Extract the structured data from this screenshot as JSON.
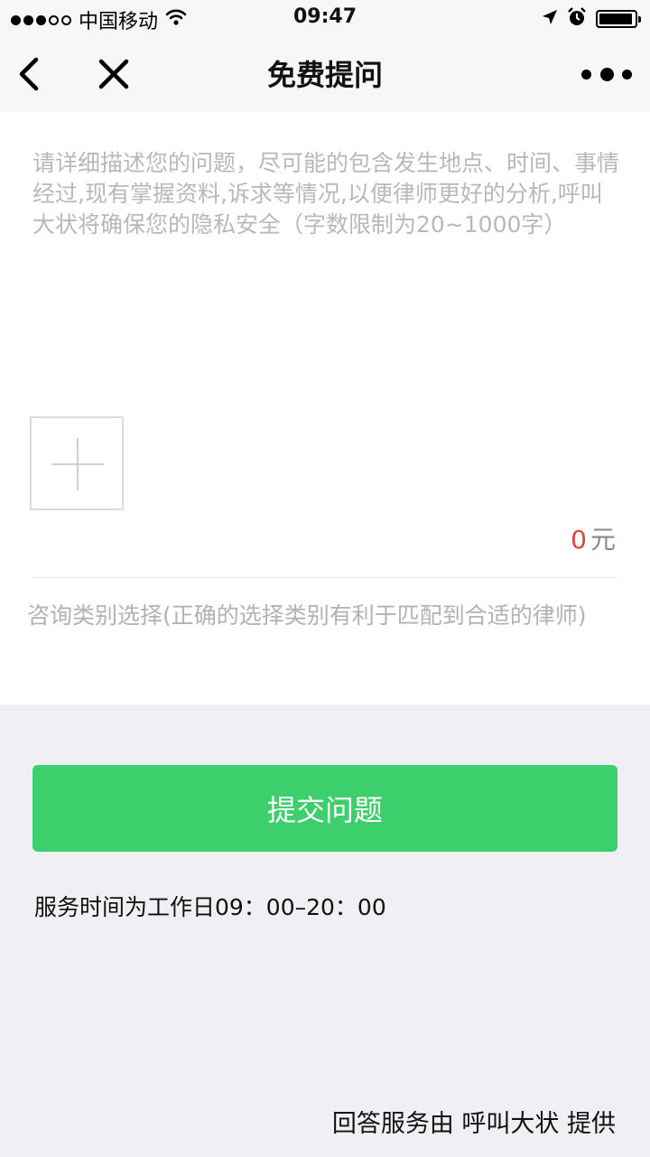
{
  "status_bar": {
    "carrier": "中国移动",
    "time": "09:47",
    "signal_bars": 3,
    "battery_level": 0.85
  },
  "nav": {
    "title": "免费提问",
    "back_icon": "chevron-left-icon",
    "close_icon": "close-icon",
    "more_icon": "more-dots-icon"
  },
  "form": {
    "question_placeholder": "请详细描述您的问题，尽可能的包含发生地点、时间、事情经过,现有掌握资料,诉求等情况,以便律师更好的分析,呼叫大状将确保您的隐私安全（字数限制为20~1000字）",
    "question_value": "",
    "upload_icon": "plus-icon",
    "price_amount": "0",
    "price_unit": "元",
    "category_placeholder": "咨询类别选择(正确的选择类别有利于匹配到合适的律师)"
  },
  "submit_label": "提交问题",
  "service_hours": "服务时间为工作日09：00–20：00",
  "provider_credit": "回答服务由 呼叫大状 提供",
  "colors": {
    "accent_green": "#3ccf6b",
    "price_red": "#e64340",
    "placeholder_gray": "#b8b8b8",
    "page_background": "#efeff4"
  }
}
